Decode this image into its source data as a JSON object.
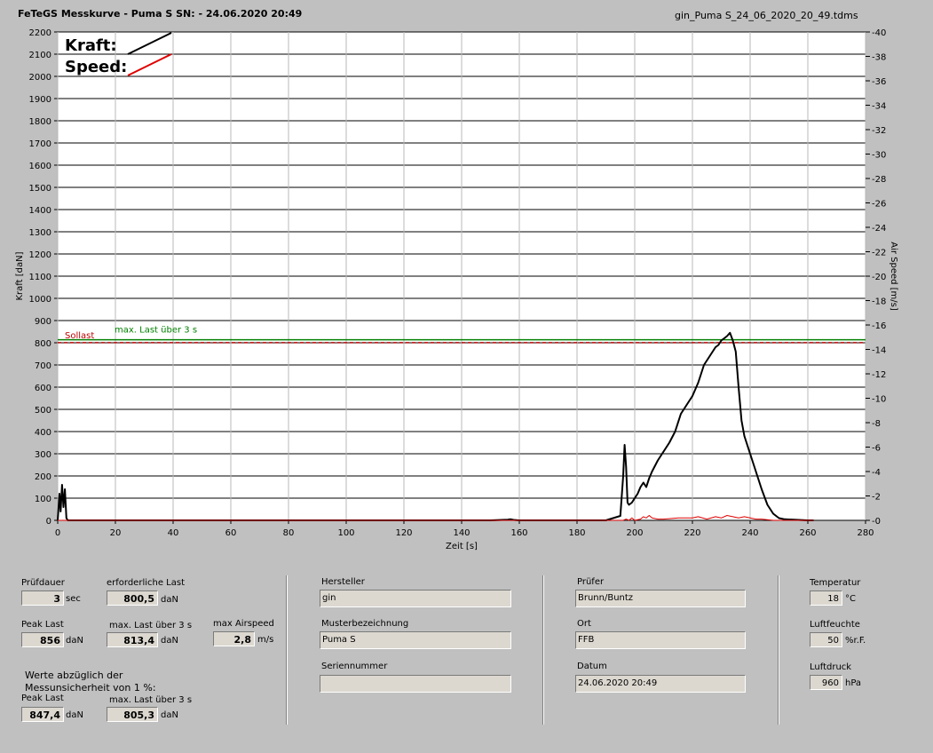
{
  "header": {
    "title": "FeTeGS Messkurve - Puma S  SN:  - 24.06.2020 20:49",
    "filename": "gin_Puma S_24_06_2020_20_49.tdms"
  },
  "chart_data": {
    "type": "line",
    "xlabel": "Zeit [s]",
    "ylabel": "Kraft [daN]",
    "y2label": "Air Speed [m/s]",
    "xlim": [
      0,
      280
    ],
    "ylim": [
      0,
      2200
    ],
    "y2lim": [
      0,
      40
    ],
    "xticks": [
      0,
      20,
      40,
      60,
      80,
      100,
      120,
      140,
      160,
      180,
      200,
      220,
      240,
      260,
      280
    ],
    "yticks": [
      0,
      100,
      200,
      300,
      400,
      500,
      600,
      700,
      800,
      900,
      1000,
      1100,
      1200,
      1300,
      1400,
      1500,
      1600,
      1700,
      1800,
      1900,
      2000,
      2100,
      2200
    ],
    "y2ticks": [
      0,
      2,
      4,
      6,
      8,
      10,
      12,
      14,
      16,
      18,
      20,
      22,
      24,
      26,
      28,
      30,
      32,
      34,
      36,
      38,
      40
    ],
    "legend": [
      {
        "name": "Kraft:",
        "color": "#000000"
      },
      {
        "name": "Speed:",
        "color": "#e00000"
      }
    ],
    "reference_lines": [
      {
        "label": "Sollast",
        "value": 800.5,
        "color": "#c00000",
        "style": "dashed"
      },
      {
        "label": "max. Last über  3 s",
        "value": 813.4,
        "color": "#008000",
        "style": "solid"
      }
    ],
    "series": [
      {
        "name": "Kraft",
        "axis": "left",
        "color": "#000000",
        "x": [
          0,
          0.6,
          1,
          1.5,
          2,
          2.5,
          3,
          3.5,
          20,
          60,
          100,
          150,
          156,
          157,
          158,
          160,
          190,
          195,
          196,
          196.5,
          197,
          197.5,
          198,
          199,
          200,
          201,
          202,
          203,
          204,
          205,
          206,
          208,
          210,
          212,
          214,
          216,
          218,
          220,
          222,
          224,
          226,
          228,
          229,
          230,
          231,
          232,
          233,
          234,
          235,
          236,
          237,
          238,
          240,
          242,
          244,
          246,
          248,
          250,
          252,
          260,
          262
        ],
        "y": [
          0,
          120,
          40,
          160,
          60,
          140,
          10,
          0,
          0,
          0,
          0,
          0,
          3,
          5,
          2,
          0,
          0,
          20,
          200,
          340,
          240,
          80,
          70,
          80,
          100,
          120,
          150,
          170,
          150,
          190,
          220,
          270,
          310,
          350,
          400,
          480,
          520,
          560,
          620,
          700,
          740,
          780,
          790,
          810,
          820,
          830,
          845,
          810,
          760,
          600,
          450,
          380,
          300,
          220,
          140,
          70,
          30,
          10,
          5,
          0,
          0
        ]
      },
      {
        "name": "Speed",
        "axis": "right",
        "color": "#e00000",
        "x": [
          0,
          196,
          197,
          198,
          199,
          200,
          202,
          203,
          204,
          205,
          206,
          208,
          210,
          215,
          220,
          222,
          225,
          228,
          230,
          232,
          234,
          236,
          238,
          240,
          242,
          244,
          248,
          262
        ],
        "y": [
          0,
          0,
          0.1,
          0,
          0.2,
          0,
          0.1,
          0.3,
          0.2,
          0.4,
          0.2,
          0.1,
          0.1,
          0.2,
          0.2,
          0.3,
          0.1,
          0.3,
          0.2,
          0.4,
          0.3,
          0.2,
          0.3,
          0.2,
          0.1,
          0.1,
          0,
          0
        ]
      }
    ]
  },
  "results": {
    "pruefdauer_label": "Prüfdauer",
    "pruefdauer_value": "3",
    "pruefdauer_unit": "sec",
    "erf_last_label": "erforderliche Last",
    "erf_last_value": "800,5",
    "erf_last_unit": "daN",
    "peak_last_label": "Peak Last",
    "peak_last_value": "856",
    "peak_last_unit": "daN",
    "max_last_label": "max. Last über  3 s",
    "max_last_value": "813,4",
    "max_last_unit": "daN",
    "max_airspeed_label": "max Airspeed",
    "max_airspeed_value": "2,8",
    "max_airspeed_unit": "m/s",
    "werte_line1": "Werte abzüglich der",
    "werte_line2": "Messunsicherheit von 1  %:",
    "peak_last2_label": "Peak Last",
    "peak_last2_value": "847,4",
    "peak_last2_unit": "daN",
    "max_last2_label": "max. Last über  3 s",
    "max_last2_value": "805,3",
    "max_last2_unit": "daN"
  },
  "info": {
    "hersteller_label": "Hersteller",
    "hersteller_value": "gin",
    "muster_label": "Musterbezeichnung",
    "muster_value": "Puma S",
    "serien_label": "Seriennummer",
    "serien_value": "",
    "pruefer_label": "Prüfer",
    "pruefer_value": "Brunn/Buntz",
    "ort_label": "Ort",
    "ort_value": "FFB",
    "datum_label": "Datum",
    "datum_value": "24.06.2020 20:49"
  },
  "env": {
    "temp_label": "Temperatur",
    "temp_value": "18",
    "temp_unit": "°C",
    "feuchte_label": "Luftfeuchte",
    "feuchte_value": "50",
    "feuchte_unit": "%r.F.",
    "druck_label": "Luftdruck",
    "druck_value": "960",
    "druck_unit": "hPa"
  }
}
